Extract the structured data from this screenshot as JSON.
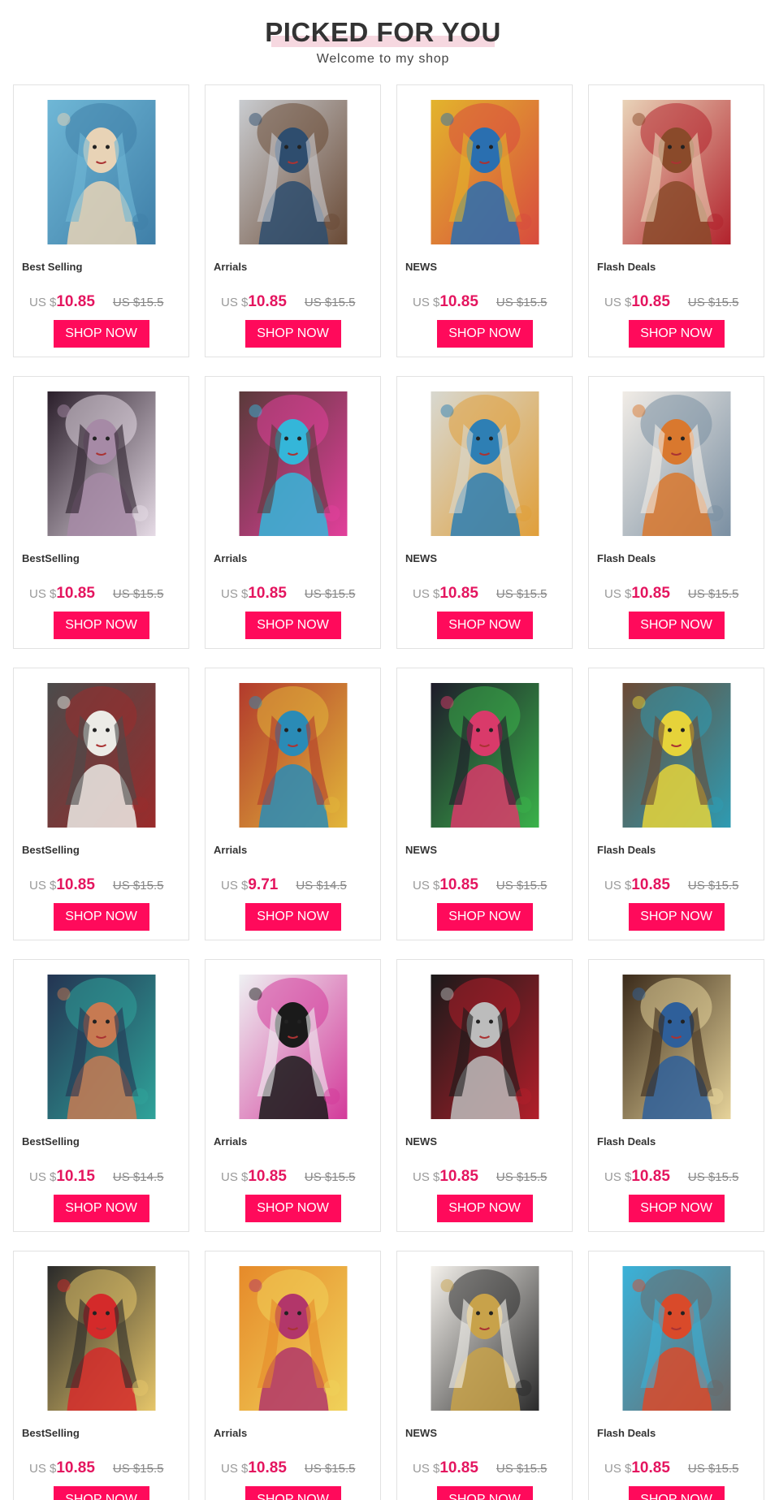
{
  "header": {
    "title": "PICKED FOR YOU",
    "subtitle": "Welcome to my shop"
  },
  "colors": {
    "accent": "#ff0a5b",
    "price": "#e4155f",
    "title_highlight": "#f6d8e0"
  },
  "products": [
    {
      "category": "Best Selling",
      "currency": "US $",
      "price": "10.85",
      "old_price": "US $15.5",
      "button": "SHOP NOW",
      "image": "painting-woman-crown-sea",
      "palette": [
        "#6fb7d6",
        "#e8d3b6",
        "#3f7fa8"
      ]
    },
    {
      "category": "Arrials",
      "currency": "US $",
      "price": "10.85",
      "old_price": "US $15.5",
      "button": "SHOP NOW",
      "image": "painting-girl-sitting-chair",
      "palette": [
        "#c9ccd0",
        "#2e4d6e",
        "#6a4a35"
      ]
    },
    {
      "category": "NEWS",
      "currency": "US $",
      "price": "10.85",
      "old_price": "US $15.5",
      "button": "SHOP NOW",
      "image": "painting-woman-flower-bird",
      "palette": [
        "#e3b42c",
        "#2a6fb0",
        "#d84b3e"
      ]
    },
    {
      "category": "Flash Deals",
      "currency": "US $",
      "price": "10.85",
      "old_price": "US $15.5",
      "button": "SHOP NOW",
      "image": "painting-woman-rose-tattoo",
      "palette": [
        "#e9d3b8",
        "#8a4a2a",
        "#b2222c"
      ]
    },
    {
      "category": "BestSelling",
      "currency": "US $",
      "price": "10.85",
      "old_price": "US $15.5",
      "button": "SHOP NOW",
      "image": "painting-skull-woman-gun",
      "palette": [
        "#2a1e2a",
        "#a68aa6",
        "#e6dbe6"
      ]
    },
    {
      "category": "Arrials",
      "currency": "US $",
      "price": "10.85",
      "old_price": "US $15.5",
      "button": "SHOP NOW",
      "image": "painting-girl-blue-pink-hair",
      "palette": [
        "#5a3a3a",
        "#34b6d9",
        "#e23f9b"
      ]
    },
    {
      "category": "NEWS",
      "currency": "US $",
      "price": "10.85",
      "old_price": "US $15.5",
      "button": "SHOP NOW",
      "image": "painting-eagle-woman",
      "palette": [
        "#d8d8d0",
        "#2e7fb4",
        "#e09f3a"
      ]
    },
    {
      "category": "Flash Deals",
      "currency": "US $",
      "price": "10.85",
      "old_price": "US $15.5",
      "button": "SHOP NOW",
      "image": "painting-redhead-white-dress",
      "palette": [
        "#f1ece6",
        "#d9782e",
        "#7a8fa2"
      ]
    },
    {
      "category": "BestSelling",
      "currency": "US $",
      "price": "10.85",
      "old_price": "US $15.5",
      "button": "SHOP NOW",
      "image": "painting-woman-white-gown",
      "palette": [
        "#4b4b4b",
        "#ecebe6",
        "#9a2b2b"
      ]
    },
    {
      "category": "Arrials",
      "currency": "US $",
      "price": "9.71",
      "old_price": "US $14.5",
      "button": "SHOP NOW",
      "image": "painting-woman-colorful-scarf",
      "palette": [
        "#b23a2c",
        "#2a8bb6",
        "#e2b63a"
      ]
    },
    {
      "category": "NEWS",
      "currency": "US $",
      "price": "10.85",
      "old_price": "US $15.5",
      "button": "SHOP NOW",
      "image": "painting-woman-flower-headdress",
      "palette": [
        "#1e1b2a",
        "#d93a6a",
        "#3ab24a"
      ]
    },
    {
      "category": "Flash Deals",
      "currency": "US $",
      "price": "10.85",
      "old_price": "US $15.5",
      "button": "SHOP NOW",
      "image": "painting-curly-hair-sunflower",
      "palette": [
        "#6b4a35",
        "#e6d33a",
        "#2e9bb2"
      ]
    },
    {
      "category": "BestSelling",
      "currency": "US $",
      "price": "10.15",
      "old_price": "US $14.5",
      "button": "SHOP NOW",
      "image": "painting-woman-reclining-moon",
      "palette": [
        "#243452",
        "#c77a52",
        "#2fa39a"
      ]
    },
    {
      "category": "Arrials",
      "currency": "US $",
      "price": "10.85",
      "old_price": "US $15.5",
      "button": "SHOP NOW",
      "image": "painting-face-guitar",
      "palette": [
        "#eef0f2",
        "#1a1a1a",
        "#d33a9a"
      ]
    },
    {
      "category": "NEWS",
      "currency": "US $",
      "price": "10.85",
      "old_price": "US $15.5",
      "button": "SHOP NOW",
      "image": "painting-skull-couple",
      "palette": [
        "#1a1a1a",
        "#bcbcbc",
        "#b21e2a"
      ]
    },
    {
      "category": "Flash Deals",
      "currency": "US $",
      "price": "10.85",
      "old_price": "US $15.5",
      "button": "SHOP NOW",
      "image": "painting-woman-blue-dress-lights",
      "palette": [
        "#3a2a1a",
        "#2e5f9a",
        "#e6d39a"
      ]
    },
    {
      "category": "BestSelling",
      "currency": "US $",
      "price": "10.85",
      "old_price": "US $15.5",
      "button": "SHOP NOW",
      "image": "painting-woman-red-dress-wine",
      "palette": [
        "#2a2a2a",
        "#d42a2a",
        "#e6c66a"
      ]
    },
    {
      "category": "Arrials",
      "currency": "US $",
      "price": "10.85",
      "old_price": "US $15.5",
      "button": "SHOP NOW",
      "image": "painting-mother-child-mosaic",
      "palette": [
        "#e68a2a",
        "#b2366a",
        "#f0d25a"
      ]
    },
    {
      "category": "NEWS",
      "currency": "US $",
      "price": "10.85",
      "old_price": "US $15.5",
      "button": "SHOP NOW",
      "image": "painting-woman-white-gold-gown",
      "palette": [
        "#f4f1ec",
        "#c8a24a",
        "#2a2a2a"
      ]
    },
    {
      "category": "Flash Deals",
      "currency": "US $",
      "price": "10.85",
      "old_price": "US $15.5",
      "button": "SHOP NOW",
      "image": "painting-woman-autumn-cup",
      "palette": [
        "#3ab2d9",
        "#d94a2a",
        "#6a6a6a"
      ]
    }
  ]
}
